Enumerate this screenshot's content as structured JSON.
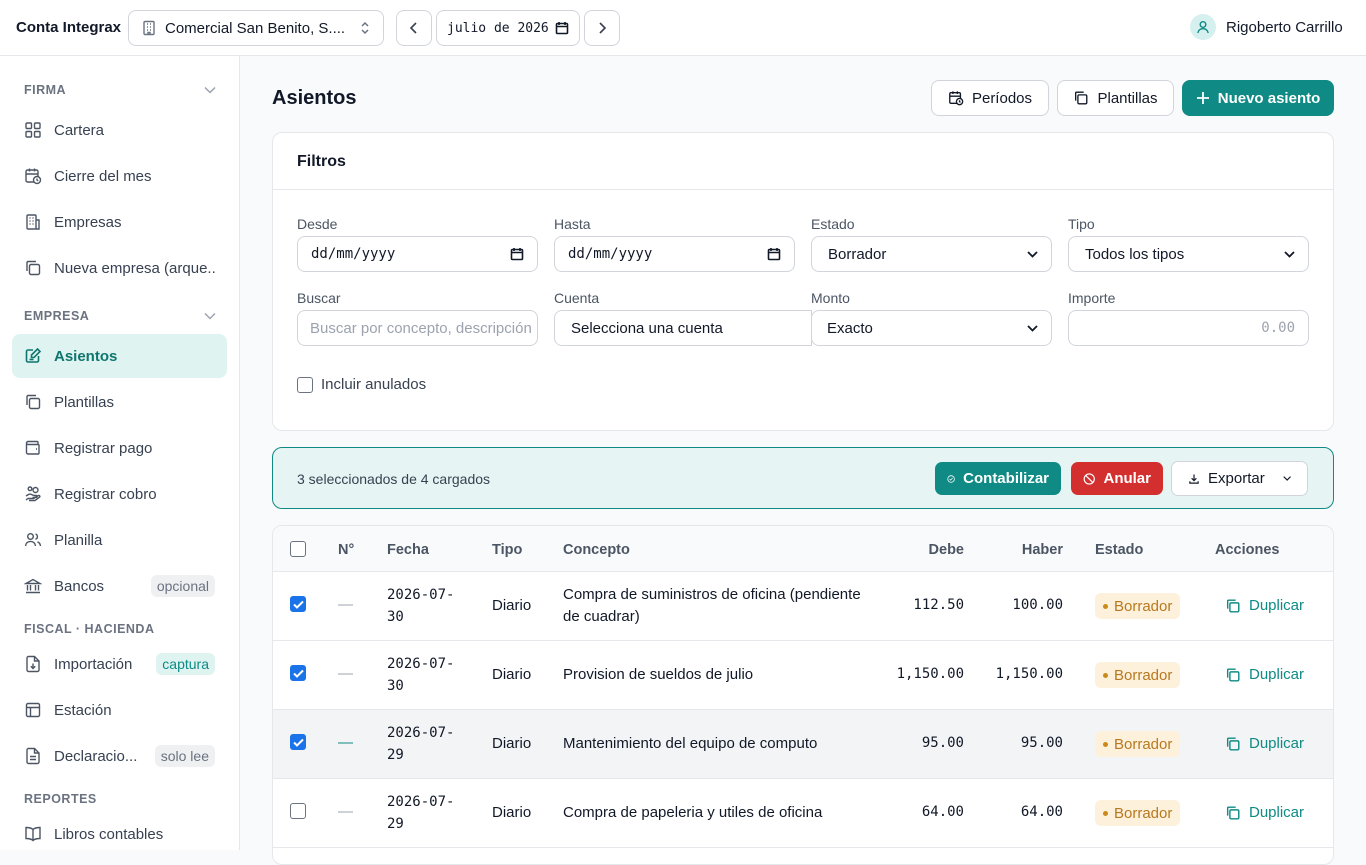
{
  "app": {
    "title": "Conta Integrax"
  },
  "topbar": {
    "company": "Comercial San Benito, S....",
    "month": "julio de 2026",
    "user": "Rigoberto Carrillo"
  },
  "sidebar": {
    "sections": {
      "firma": "FIRMA",
      "empresa": "EMPRESA",
      "fiscal": "FISCAL · HACIENDA",
      "reportes": "REPORTES"
    },
    "items": [
      {
        "label": "Cartera",
        "icon": "grid-icon"
      },
      {
        "label": "Cierre del mes",
        "icon": "calendar-clock-icon"
      },
      {
        "label": "Empresas",
        "icon": "building-icon"
      },
      {
        "label": "Nueva empresa (arque...",
        "icon": "copy-icon"
      },
      {
        "label": "Asientos",
        "icon": "edit-note-icon",
        "active": true
      },
      {
        "label": "Plantillas",
        "icon": "copy-icon"
      },
      {
        "label": "Registrar pago",
        "icon": "wallet-icon"
      },
      {
        "label": "Registrar cobro",
        "icon": "hand-coins-icon"
      },
      {
        "label": "Planilla",
        "icon": "users-icon"
      },
      {
        "label": "Bancos",
        "icon": "bank-icon",
        "tag": "opcional"
      },
      {
        "label": "Importación",
        "icon": "file-import-icon",
        "tag": "captura"
      },
      {
        "label": "Estación",
        "icon": "layout-icon"
      },
      {
        "label": "Declaracio...",
        "icon": "document-icon",
        "tag": "solo lee"
      },
      {
        "label": "Libros contables",
        "icon": "book-icon"
      }
    ]
  },
  "page": {
    "title": "Asientos",
    "buttons": {
      "periodos": "Períodos",
      "plantillas": "Plantillas",
      "nuevo": "Nuevo asiento"
    }
  },
  "filters": {
    "title": "Filtros",
    "desde": {
      "label": "Desde",
      "value": "dd/mm/yyyy"
    },
    "hasta": {
      "label": "Hasta",
      "value": "dd/mm/yyyy"
    },
    "estado": {
      "label": "Estado",
      "value": "Borrador"
    },
    "tipo": {
      "label": "Tipo",
      "value": "Todos los tipos"
    },
    "buscar": {
      "label": "Buscar",
      "placeholder": "Buscar por concepto, descripción"
    },
    "cuenta": {
      "label": "Cuenta",
      "value": "Selecciona una cuenta"
    },
    "monto": {
      "label": "Monto",
      "value": "Exacto"
    },
    "importe": {
      "label": "Importe",
      "placeholder": "0.00"
    },
    "anulados": "Incluir anulados"
  },
  "bulk": {
    "selected": "3 seleccionados de 4 cargados",
    "contabilizar": "Contabilizar",
    "anular": "Anular",
    "exportar": "Exportar"
  },
  "table": {
    "headers": {
      "num": "N°",
      "fecha": "Fecha",
      "tipo": "Tipo",
      "concepto": "Concepto",
      "debe": "Debe",
      "haber": "Haber",
      "estado": "Estado",
      "acciones": "Acciones"
    },
    "rows": [
      {
        "checked": true,
        "num": "—",
        "fecha1": "2026-07-",
        "fecha2": "30",
        "tipo": "Diario",
        "concepto": "Compra de suministros de oficina (pendiente de cuadrar)",
        "debe": "112.50",
        "haber": "100.00",
        "estado": "Borrador",
        "accion": "Duplicar"
      },
      {
        "checked": true,
        "num": "—",
        "fecha1": "2026-07-",
        "fecha2": "30",
        "tipo": "Diario",
        "concepto": "Provision de sueldos de julio",
        "debe": "1,150.00",
        "haber": "1,150.00",
        "estado": "Borrador",
        "accion": "Duplicar"
      },
      {
        "checked": true,
        "num": "—",
        "fecha1": "2026-07-",
        "fecha2": "29",
        "tipo": "Diario",
        "concepto": "Mantenimiento del equipo de computo",
        "debe": "95.00",
        "haber": "95.00",
        "estado": "Borrador",
        "accion": "Duplicar"
      },
      {
        "checked": false,
        "num": "—",
        "fecha1": "2026-07-",
        "fecha2": "29",
        "tipo": "Diario",
        "concepto": "Compra de papeleria y utiles de oficina",
        "debe": "64.00",
        "haber": "64.00",
        "estado": "Borrador",
        "accion": "Duplicar"
      }
    ]
  },
  "colors": {
    "accent": "#0f8a84",
    "danger": "#d32f2f",
    "warning_bg": "#fdf1dc"
  }
}
